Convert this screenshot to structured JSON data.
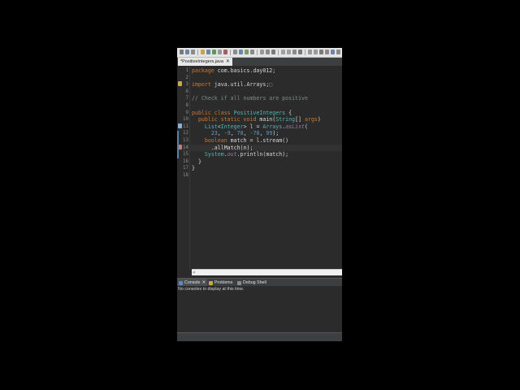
{
  "editor_tab": {
    "label": "*PositiveIntegers.java",
    "close": "✕"
  },
  "code_lines": [
    {
      "n": "1",
      "tokens": [
        [
          "kw",
          "package "
        ],
        [
          "",
          ""
        ],
        [
          "str",
          "com.basics.day012;"
        ]
      ]
    },
    {
      "n": "2",
      "tokens": []
    },
    {
      "n": "3",
      "tokens": [
        [
          "kw",
          "import "
        ],
        [
          "str",
          "java.util.Arrays;"
        ],
        [
          "cm",
          "□"
        ]
      ]
    },
    {
      "n": "6",
      "tokens": []
    },
    {
      "n": "7",
      "tokens": [
        [
          "cm",
          "// Check if all numbers are positive"
        ]
      ]
    },
    {
      "n": "8",
      "tokens": []
    },
    {
      "n": "9",
      "tokens": [
        [
          "kw",
          "public class "
        ],
        [
          "cls",
          "PositiveIntegers"
        ],
        [
          "str",
          " {"
        ]
      ]
    },
    {
      "n": "10",
      "tokens": [
        [
          "str",
          "  "
        ],
        [
          "kw",
          "public static void "
        ],
        [
          "mth",
          "main("
        ],
        [
          "cls",
          "String"
        ],
        [
          "str",
          "[] "
        ],
        [
          "kw",
          "args"
        ],
        [
          "str",
          ")"
        ]
      ]
    },
    {
      "n": "11",
      "tokens": [
        [
          "str",
          "    "
        ],
        [
          "cls",
          "List"
        ],
        [
          "str",
          "<"
        ],
        [
          "cls",
          "Integer"
        ],
        [
          "str",
          "> l = "
        ],
        [
          "cls",
          "Arrays"
        ],
        [
          "str",
          "."
        ],
        [
          "st",
          "asList"
        ],
        [
          "str",
          "("
        ]
      ]
    },
    {
      "n": "12",
      "tokens": [
        [
          "str",
          "      "
        ],
        [
          "num",
          "23"
        ],
        [
          "str",
          ", "
        ],
        [
          "num",
          "-9"
        ],
        [
          "str",
          ", "
        ],
        [
          "num",
          "78"
        ],
        [
          "str",
          ", "
        ],
        [
          "num",
          "-78"
        ],
        [
          "str",
          ", "
        ],
        [
          "num",
          "99"
        ],
        [
          "str",
          ");"
        ]
      ]
    },
    {
      "n": "13",
      "tokens": [
        [
          "str",
          "    "
        ],
        [
          "kw",
          "boolean "
        ],
        [
          "str",
          "match = l.stream()"
        ]
      ]
    },
    {
      "n": "14",
      "tokens": [
        [
          "str",
          "      .allMatch("
        ],
        [
          "str",
          "n"
        ],
        [
          "str",
          ");"
        ]
      ]
    },
    {
      "n": "15",
      "tokens": [
        [
          "str",
          "    "
        ],
        [
          "cls",
          "System"
        ],
        [
          "str",
          "."
        ],
        [
          "st",
          "out"
        ],
        [
          "str",
          ".println(match);"
        ]
      ]
    },
    {
      "n": "16",
      "tokens": [
        [
          "str",
          "  }"
        ]
      ]
    },
    {
      "n": "17",
      "tokens": [
        [
          "str",
          "}"
        ]
      ]
    },
    {
      "n": "18",
      "tokens": []
    }
  ],
  "bottom_tabs": [
    {
      "label": "Console",
      "active": true,
      "close": "✕"
    },
    {
      "label": "Problems",
      "active": false
    },
    {
      "label": "Debug Shell",
      "active": false
    }
  ],
  "console_message": "No consoles to display at this time.",
  "icons": {
    "console": "console-icon",
    "problems": "problems-icon",
    "debug_shell": "debug-shell-icon",
    "import_marker": "folded-import-marker-icon",
    "warning_marker": "warning-marker-icon"
  },
  "colors": {
    "background": "#2b2b2b",
    "keyword": "#cc7832",
    "class": "#4fb6b6",
    "comment": "#7f8c8d",
    "number": "#6897bb"
  }
}
